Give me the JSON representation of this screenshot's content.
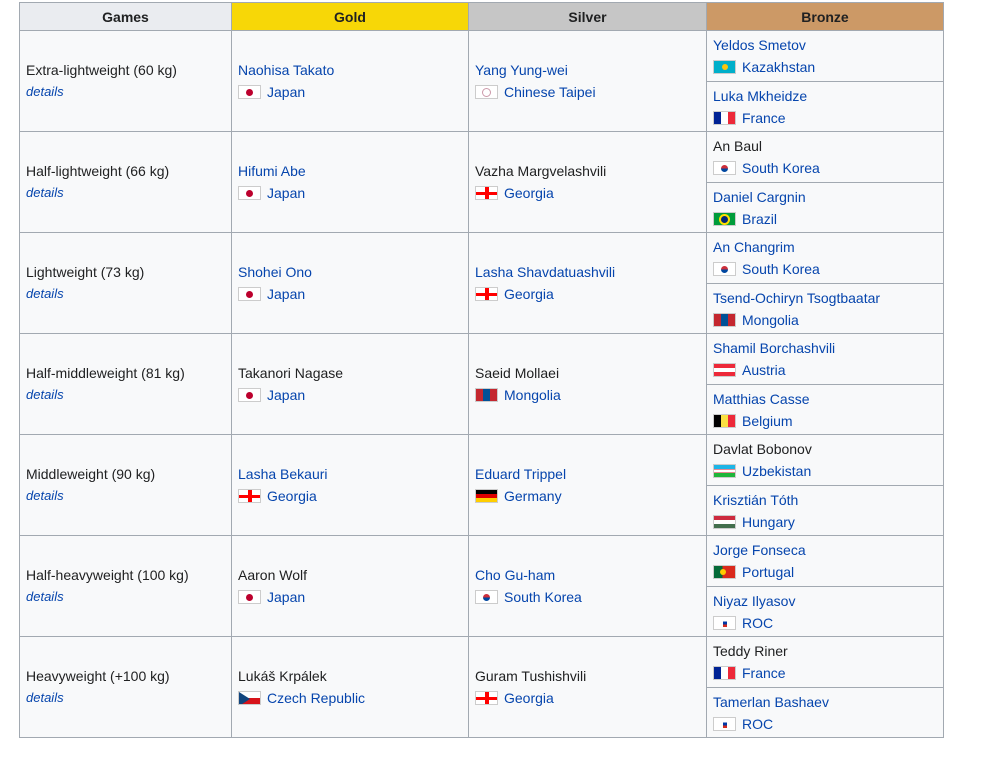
{
  "header": {
    "games": "Games",
    "gold": "Gold",
    "silver": "Silver",
    "bronze": "Bronze"
  },
  "colors": {
    "gold": "#f7d707",
    "silver": "#c6c6c6",
    "bronze": "#cc9966",
    "link": "#0645ad"
  },
  "events": [
    {
      "name": "Extra-lightweight (60 kg)",
      "details": "details",
      "gold": {
        "athlete": "Naohisa Takato",
        "country": "Japan",
        "flag": "japan-flag-icon"
      },
      "silver": {
        "athlete": "Yang Yung-wei",
        "country": "Chinese Taipei",
        "flag": "chinese-taipei-flag-icon"
      },
      "bronze": [
        {
          "athlete": "Yeldos Smetov",
          "country": "Kazakhstan",
          "flag": "kazakhstan-flag-icon"
        },
        {
          "athlete": "Luka Mkheidze",
          "country": "France",
          "flag": "france-flag-icon"
        }
      ]
    },
    {
      "name": "Half-lightweight (66 kg)",
      "details": "details",
      "gold": {
        "athlete": "Hifumi Abe",
        "country": "Japan",
        "flag": "japan-flag-icon"
      },
      "silver": {
        "athlete": "Vazha Margvelashvili",
        "country": "Georgia",
        "flag": "georgia-flag-icon"
      },
      "bronze": [
        {
          "athlete": "An Baul",
          "country": "South Korea",
          "flag": "south-korea-flag-icon"
        },
        {
          "athlete": "Daniel Cargnin",
          "country": "Brazil",
          "flag": "brazil-flag-icon"
        }
      ]
    },
    {
      "name": "Lightweight (73 kg)",
      "details": "details",
      "gold": {
        "athlete": "Shohei Ono",
        "country": "Japan",
        "flag": "japan-flag-icon"
      },
      "silver": {
        "athlete": "Lasha Shavdatuashvili",
        "country": "Georgia",
        "flag": "georgia-flag-icon"
      },
      "bronze": [
        {
          "athlete": "An Changrim",
          "country": "South Korea",
          "flag": "south-korea-flag-icon"
        },
        {
          "athlete": "Tsend-Ochiryn Tsogtbaatar",
          "country": "Mongolia",
          "flag": "mongolia-flag-icon"
        }
      ]
    },
    {
      "name": "Half-middleweight (81 kg)",
      "details": "details",
      "gold": {
        "athlete": "Takanori Nagase",
        "country": "Japan",
        "flag": "japan-flag-icon"
      },
      "silver": {
        "athlete": "Saeid Mollaei",
        "country": "Mongolia",
        "flag": "mongolia-flag-icon"
      },
      "bronze": [
        {
          "athlete": "Shamil Borchashvili",
          "country": "Austria",
          "flag": "austria-flag-icon"
        },
        {
          "athlete": "Matthias Casse",
          "country": "Belgium",
          "flag": "belgium-flag-icon"
        }
      ]
    },
    {
      "name": "Middleweight (90 kg)",
      "details": "details",
      "gold": {
        "athlete": "Lasha Bekauri",
        "country": "Georgia",
        "flag": "georgia-flag-icon"
      },
      "silver": {
        "athlete": "Eduard Trippel",
        "country": "Germany",
        "flag": "germany-flag-icon"
      },
      "bronze": [
        {
          "athlete": "Davlat Bobonov",
          "country": "Uzbekistan",
          "flag": "uzbekistan-flag-icon"
        },
        {
          "athlete": "Krisztián Tóth",
          "country": "Hungary",
          "flag": "hungary-flag-icon"
        }
      ]
    },
    {
      "name": "Half-heavyweight (100 kg)",
      "details": "details",
      "gold": {
        "athlete": "Aaron Wolf",
        "country": "Japan",
        "flag": "japan-flag-icon"
      },
      "silver": {
        "athlete": "Cho Gu-ham",
        "country": "South Korea",
        "flag": "south-korea-flag-icon"
      },
      "bronze": [
        {
          "athlete": "Jorge Fonseca",
          "country": "Portugal",
          "flag": "portugal-flag-icon"
        },
        {
          "athlete": "Niyaz Ilyasov",
          "country": "ROC",
          "flag": "roc-flag-icon"
        }
      ]
    },
    {
      "name": "Heavyweight (+100 kg)",
      "details": "details",
      "gold": {
        "athlete": "Lukáš Krpálek",
        "country": "Czech Republic",
        "flag": "czech-republic-flag-icon"
      },
      "silver": {
        "athlete": "Guram Tushishvili",
        "country": "Georgia",
        "flag": "georgia-flag-icon"
      },
      "bronze": [
        {
          "athlete": "Teddy Riner",
          "country": "France",
          "flag": "france-flag-icon"
        },
        {
          "athlete": "Tamerlan Bashaev",
          "country": "ROC",
          "flag": "roc-flag-icon"
        }
      ]
    }
  ]
}
